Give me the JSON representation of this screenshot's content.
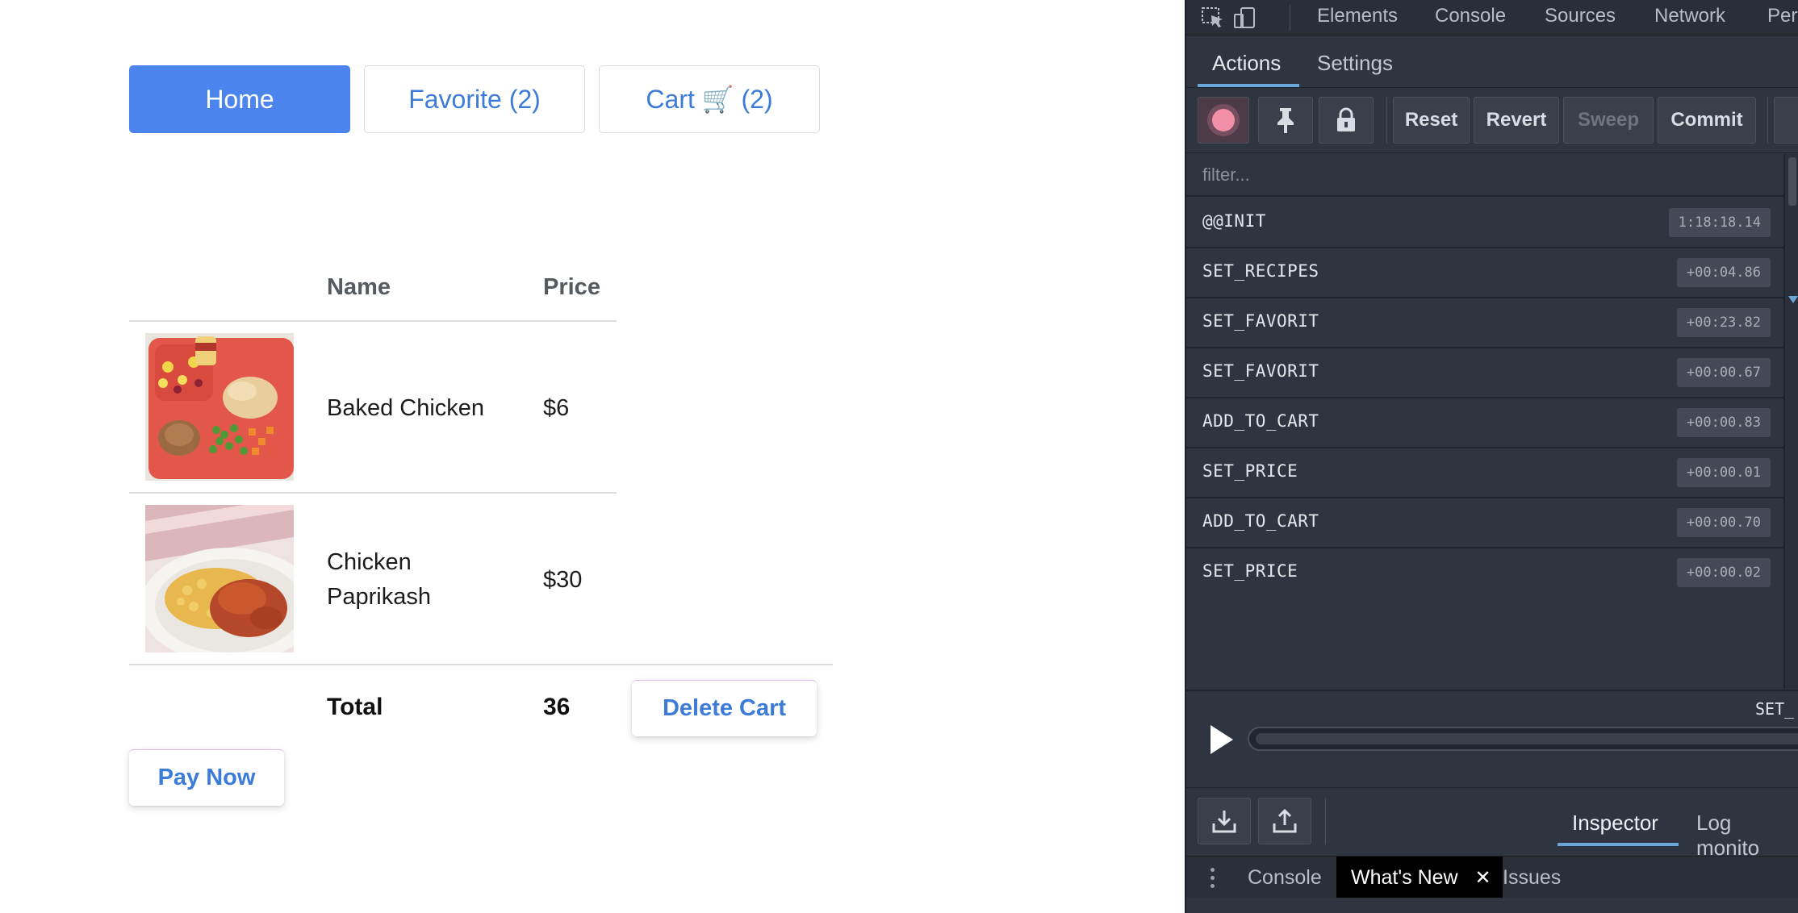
{
  "nav": {
    "home": "Home",
    "favorite": "Favorite (2)",
    "cart": "Cart 🛒 (2)"
  },
  "table": {
    "headers": {
      "name": "Name",
      "price": "Price"
    },
    "rows": [
      {
        "name": "Baked Chicken",
        "price": "$6",
        "image": "baked-chicken-tray"
      },
      {
        "name": "Chicken Paprikash",
        "price": "$30",
        "image": "chicken-paprikash-plate"
      }
    ],
    "total_label": "Total",
    "total_value": "36"
  },
  "buttons": {
    "delete_cart": "Delete Cart",
    "pay_now": "Pay Now"
  },
  "devtools": {
    "tabs": [
      "Elements",
      "Console",
      "Sources",
      "Network",
      "Perf"
    ],
    "monitor_tabs": [
      "Actions",
      "Settings"
    ],
    "toolbar": {
      "icons": [
        "record-icon",
        "pin-icon",
        "lock-icon"
      ],
      "reset": "Reset",
      "revert": "Revert",
      "sweep": "Sweep",
      "commit": "Commit"
    },
    "filter_placeholder": "filter...",
    "actions": [
      {
        "name": "@@INIT",
        "time": "1:18:18.14"
      },
      {
        "name": "SET_RECIPES",
        "time": "+00:04.86"
      },
      {
        "name": "SET_FAVORIT",
        "time": "+00:23.82"
      },
      {
        "name": "SET_FAVORIT",
        "time": "+00:00.67"
      },
      {
        "name": "ADD_TO_CART",
        "time": "+00:00.83"
      },
      {
        "name": "SET_PRICE",
        "time": "+00:00.01"
      },
      {
        "name": "ADD_TO_CART",
        "time": "+00:00.70"
      },
      {
        "name": "SET_PRICE",
        "time": "+00:00.02"
      }
    ],
    "slider_label": "SET_",
    "bottom_tabs": [
      "Inspector",
      "Log monito"
    ],
    "drawer_tabs": [
      "Console",
      "What's New",
      "Issues"
    ]
  },
  "colors": {
    "primary": "#4c84ee",
    "link": "#3d7bd8",
    "devtools_bg": "#2f3441",
    "accent_underline": "#6aa7d9"
  }
}
